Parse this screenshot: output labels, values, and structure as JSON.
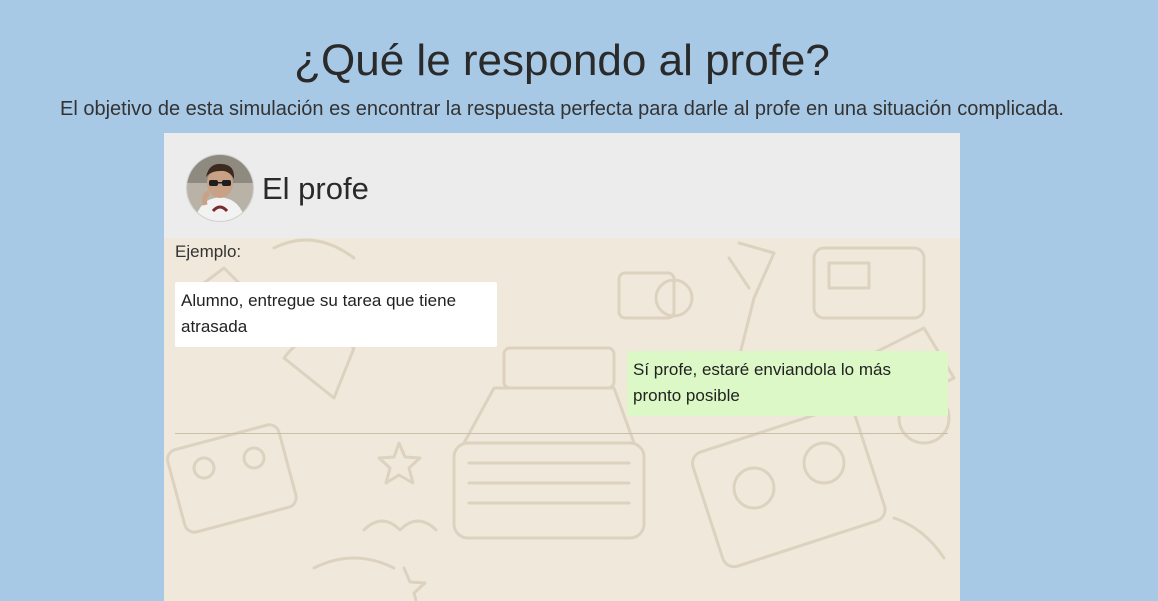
{
  "page": {
    "title": "¿Qué le respondo al profe?",
    "subtitle": "El objetivo de esta simulación es encontrar la respuesta perfecta para darle al profe en una situación complicada."
  },
  "chat": {
    "contact_name": "El profe",
    "example_label": "Ejemplo:",
    "messages": [
      {
        "direction": "incoming",
        "text": "Alumno, entregue su tarea que tiene atrasada"
      },
      {
        "direction": "outgoing",
        "text": "Sí profe, estaré enviandola lo más pronto posible"
      }
    ]
  },
  "colors": {
    "page_background": "#a8c9e6",
    "header_background": "#ececec",
    "chat_background": "#f0e8da",
    "incoming_bubble": "#ffffff",
    "outgoing_bubble": "#dcf8c6"
  }
}
